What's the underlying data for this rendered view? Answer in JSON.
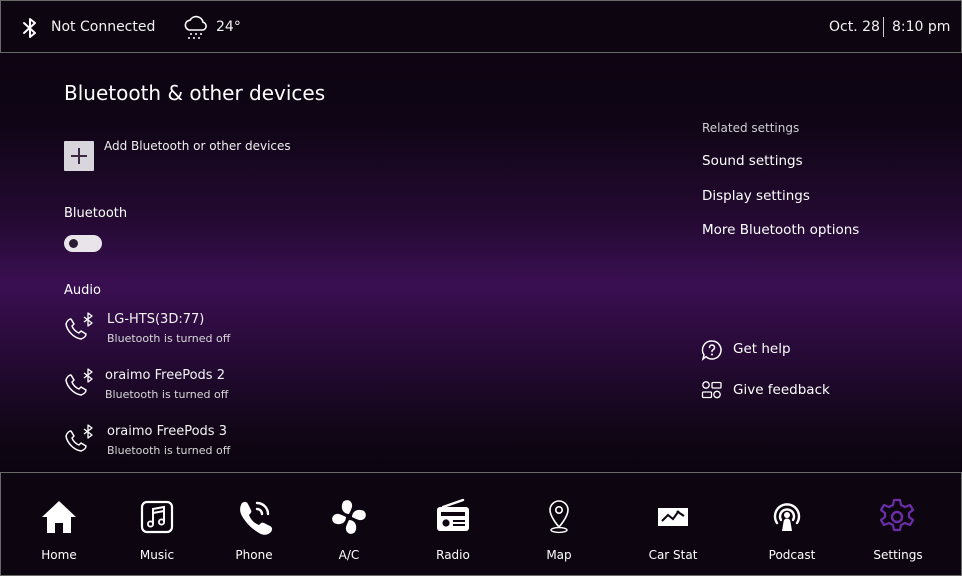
{
  "status_bar": {
    "connection": "Not Connected",
    "temperature": "24°",
    "date": "Oct. 28",
    "time": "8:10 pm",
    "icons": [
      "bluetooth-icon",
      "snow-cloud-icon"
    ]
  },
  "main": {
    "title": "Bluetooth & other devices",
    "add_device_label": "Add Bluetooth or other devices",
    "bluetooth_heading": "Bluetooth",
    "bluetooth_toggle_on": false,
    "audio_heading": "Audio",
    "devices": [
      {
        "name": "LG-HTS(3D:77)",
        "status": "Bluetooth is turned off"
      },
      {
        "name": "oraimo FreePods 2",
        "status": "Bluetooth is turned off"
      },
      {
        "name": "oraimo FreePods 3",
        "status": "Bluetooth is turned off"
      }
    ]
  },
  "related": {
    "heading": "Related settings",
    "links": [
      "Sound settings",
      "Display settings",
      "More Bluetooth options"
    ],
    "get_help": "Get help",
    "give_feedback": "Give feedback"
  },
  "nav": {
    "items": [
      {
        "label": "Home",
        "icon": "home-icon"
      },
      {
        "label": "Music",
        "icon": "music-icon"
      },
      {
        "label": "Phone",
        "icon": "phone-icon"
      },
      {
        "label": "A/C",
        "icon": "fan-icon"
      },
      {
        "label": "Radio",
        "icon": "radio-icon"
      },
      {
        "label": "Map",
        "icon": "map-pin-icon"
      },
      {
        "label": "Car Stat",
        "icon": "car-stat-icon"
      },
      {
        "label": "Podcast",
        "icon": "podcast-icon"
      },
      {
        "label": "Settings",
        "icon": "gear-icon"
      }
    ],
    "active": "Settings",
    "active_color": "#6b2ea8"
  }
}
